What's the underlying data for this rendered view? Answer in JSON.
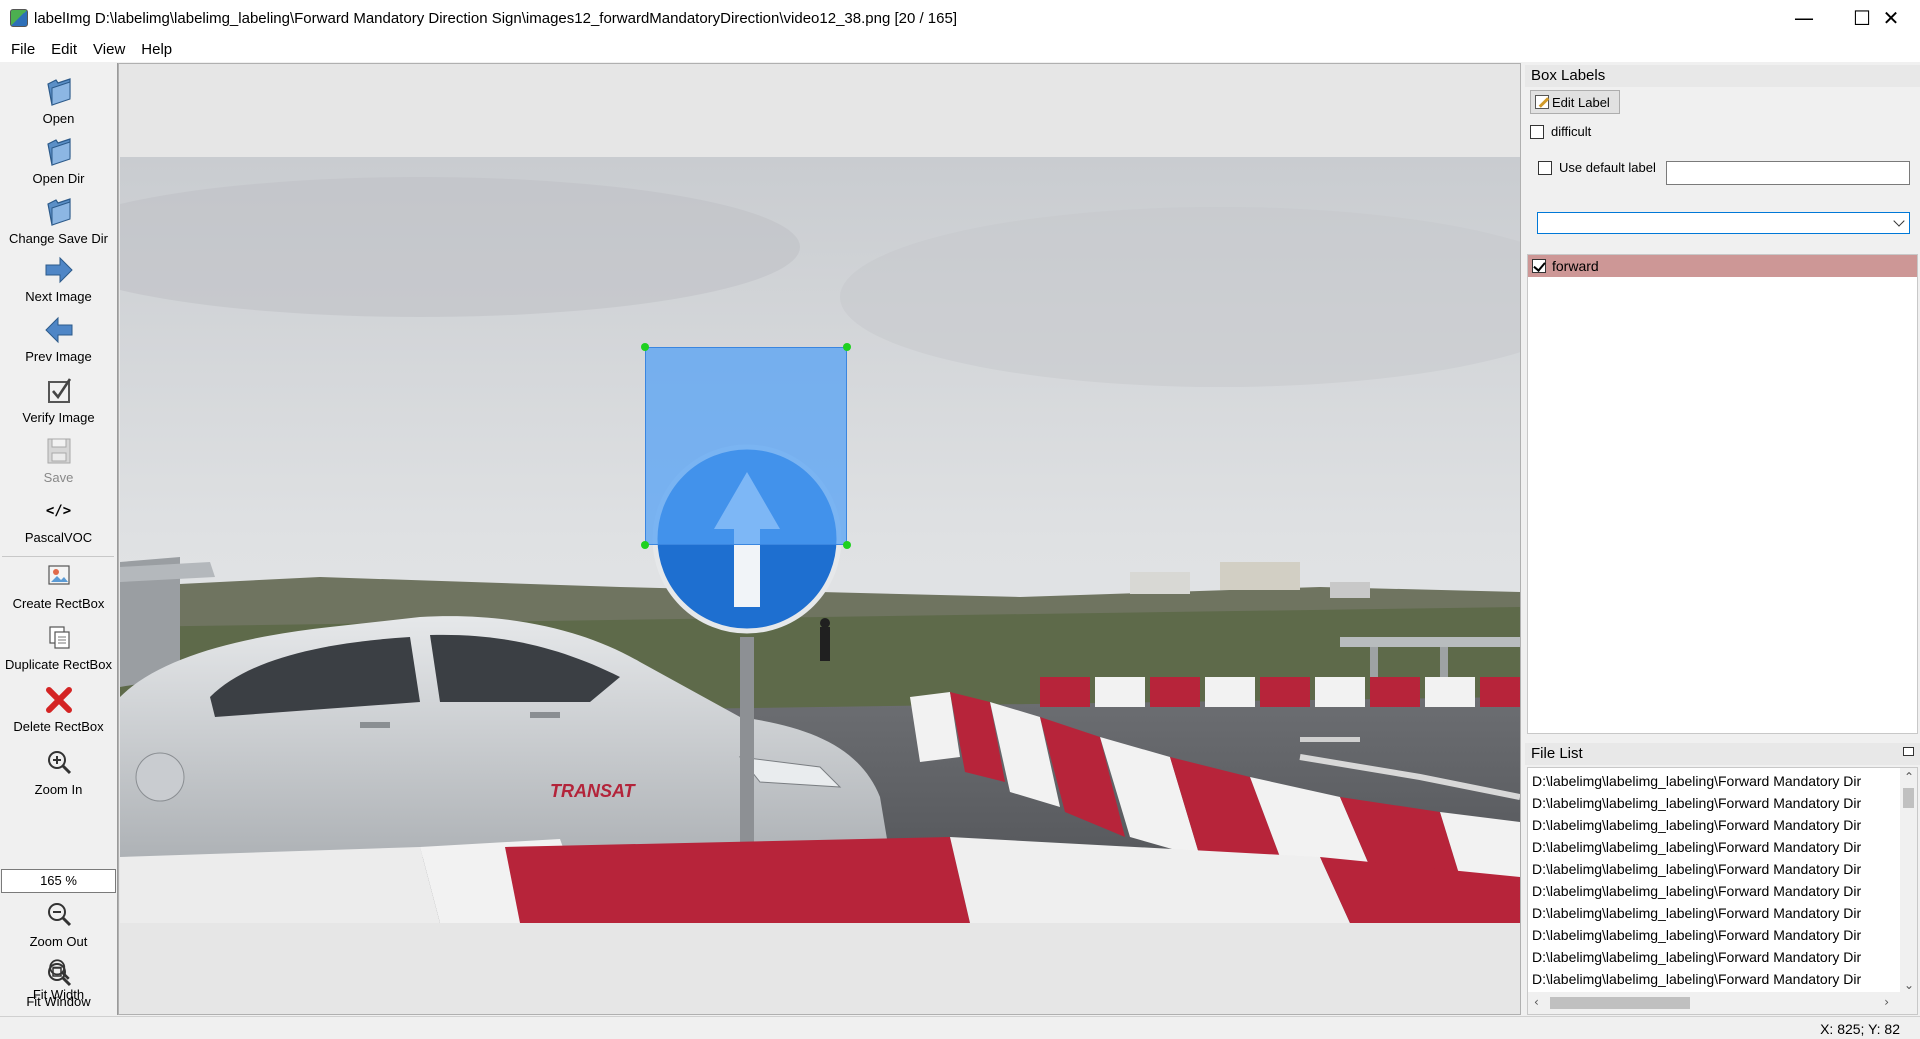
{
  "window": {
    "title": "labelImg D:\\labelimg\\labelimg_labeling\\Forward Mandatory Direction Sign\\images12_forwardMandatoryDirection\\video12_38.png [20 / 165]",
    "minimize": "—",
    "maximize": "☐",
    "close": "✕"
  },
  "menu": [
    "File",
    "Edit",
    "View",
    "Help"
  ],
  "toolbar": {
    "open": "Open",
    "open_dir": "Open Dir",
    "change_save_dir": "Change Save Dir",
    "next_image": "Next Image",
    "prev_image": "Prev Image",
    "verify_image": "Verify Image",
    "save": "Save",
    "format_icon": "</>",
    "format": "PascalVOC",
    "create_rectbox": "Create RectBox",
    "duplicate_rectbox": "Duplicate RectBox",
    "delete_rectbox": "Delete RectBox",
    "zoom_in": "Zoom In",
    "zoom_value": "165 %",
    "zoom_out": "Zoom Out",
    "fit_window": "Fit Window",
    "fit_width": "Fit Width"
  },
  "box_labels": {
    "title": "Box Labels",
    "edit_label": "Edit Label",
    "difficult": "difficult",
    "difficult_checked": false,
    "use_default_label": "Use default label",
    "use_default_checked": false,
    "default_label_value": "",
    "labels": [
      {
        "name": "forward",
        "checked": true,
        "color": "#cd9796"
      }
    ]
  },
  "file_list": {
    "title": "File List",
    "items": [
      "D:\\labelimg\\labelimg_labeling\\Forward Mandatory Dir",
      "D:\\labelimg\\labelimg_labeling\\Forward Mandatory Dir",
      "D:\\labelimg\\labelimg_labeling\\Forward Mandatory Dir",
      "D:\\labelimg\\labelimg_labeling\\Forward Mandatory Dir",
      "D:\\labelimg\\labelimg_labeling\\Forward Mandatory Dir",
      "D:\\labelimg\\labelimg_labeling\\Forward Mandatory Dir",
      "D:\\labelimg\\labelimg_labeling\\Forward Mandatory Dir",
      "D:\\labelimg\\labelimg_labeling\\Forward Mandatory Dir",
      "D:\\labelimg\\labelimg_labeling\\Forward Mandatory Dir",
      "D:\\labelimg\\labelimg_labeling\\Forward Mandatory Dir"
    ]
  },
  "status": {
    "coords": "X: 825; Y: 82"
  },
  "colors": {
    "bbox_fill": "#50a0f5",
    "handle": "#1fd11f",
    "selected_label": "#cd9796"
  }
}
